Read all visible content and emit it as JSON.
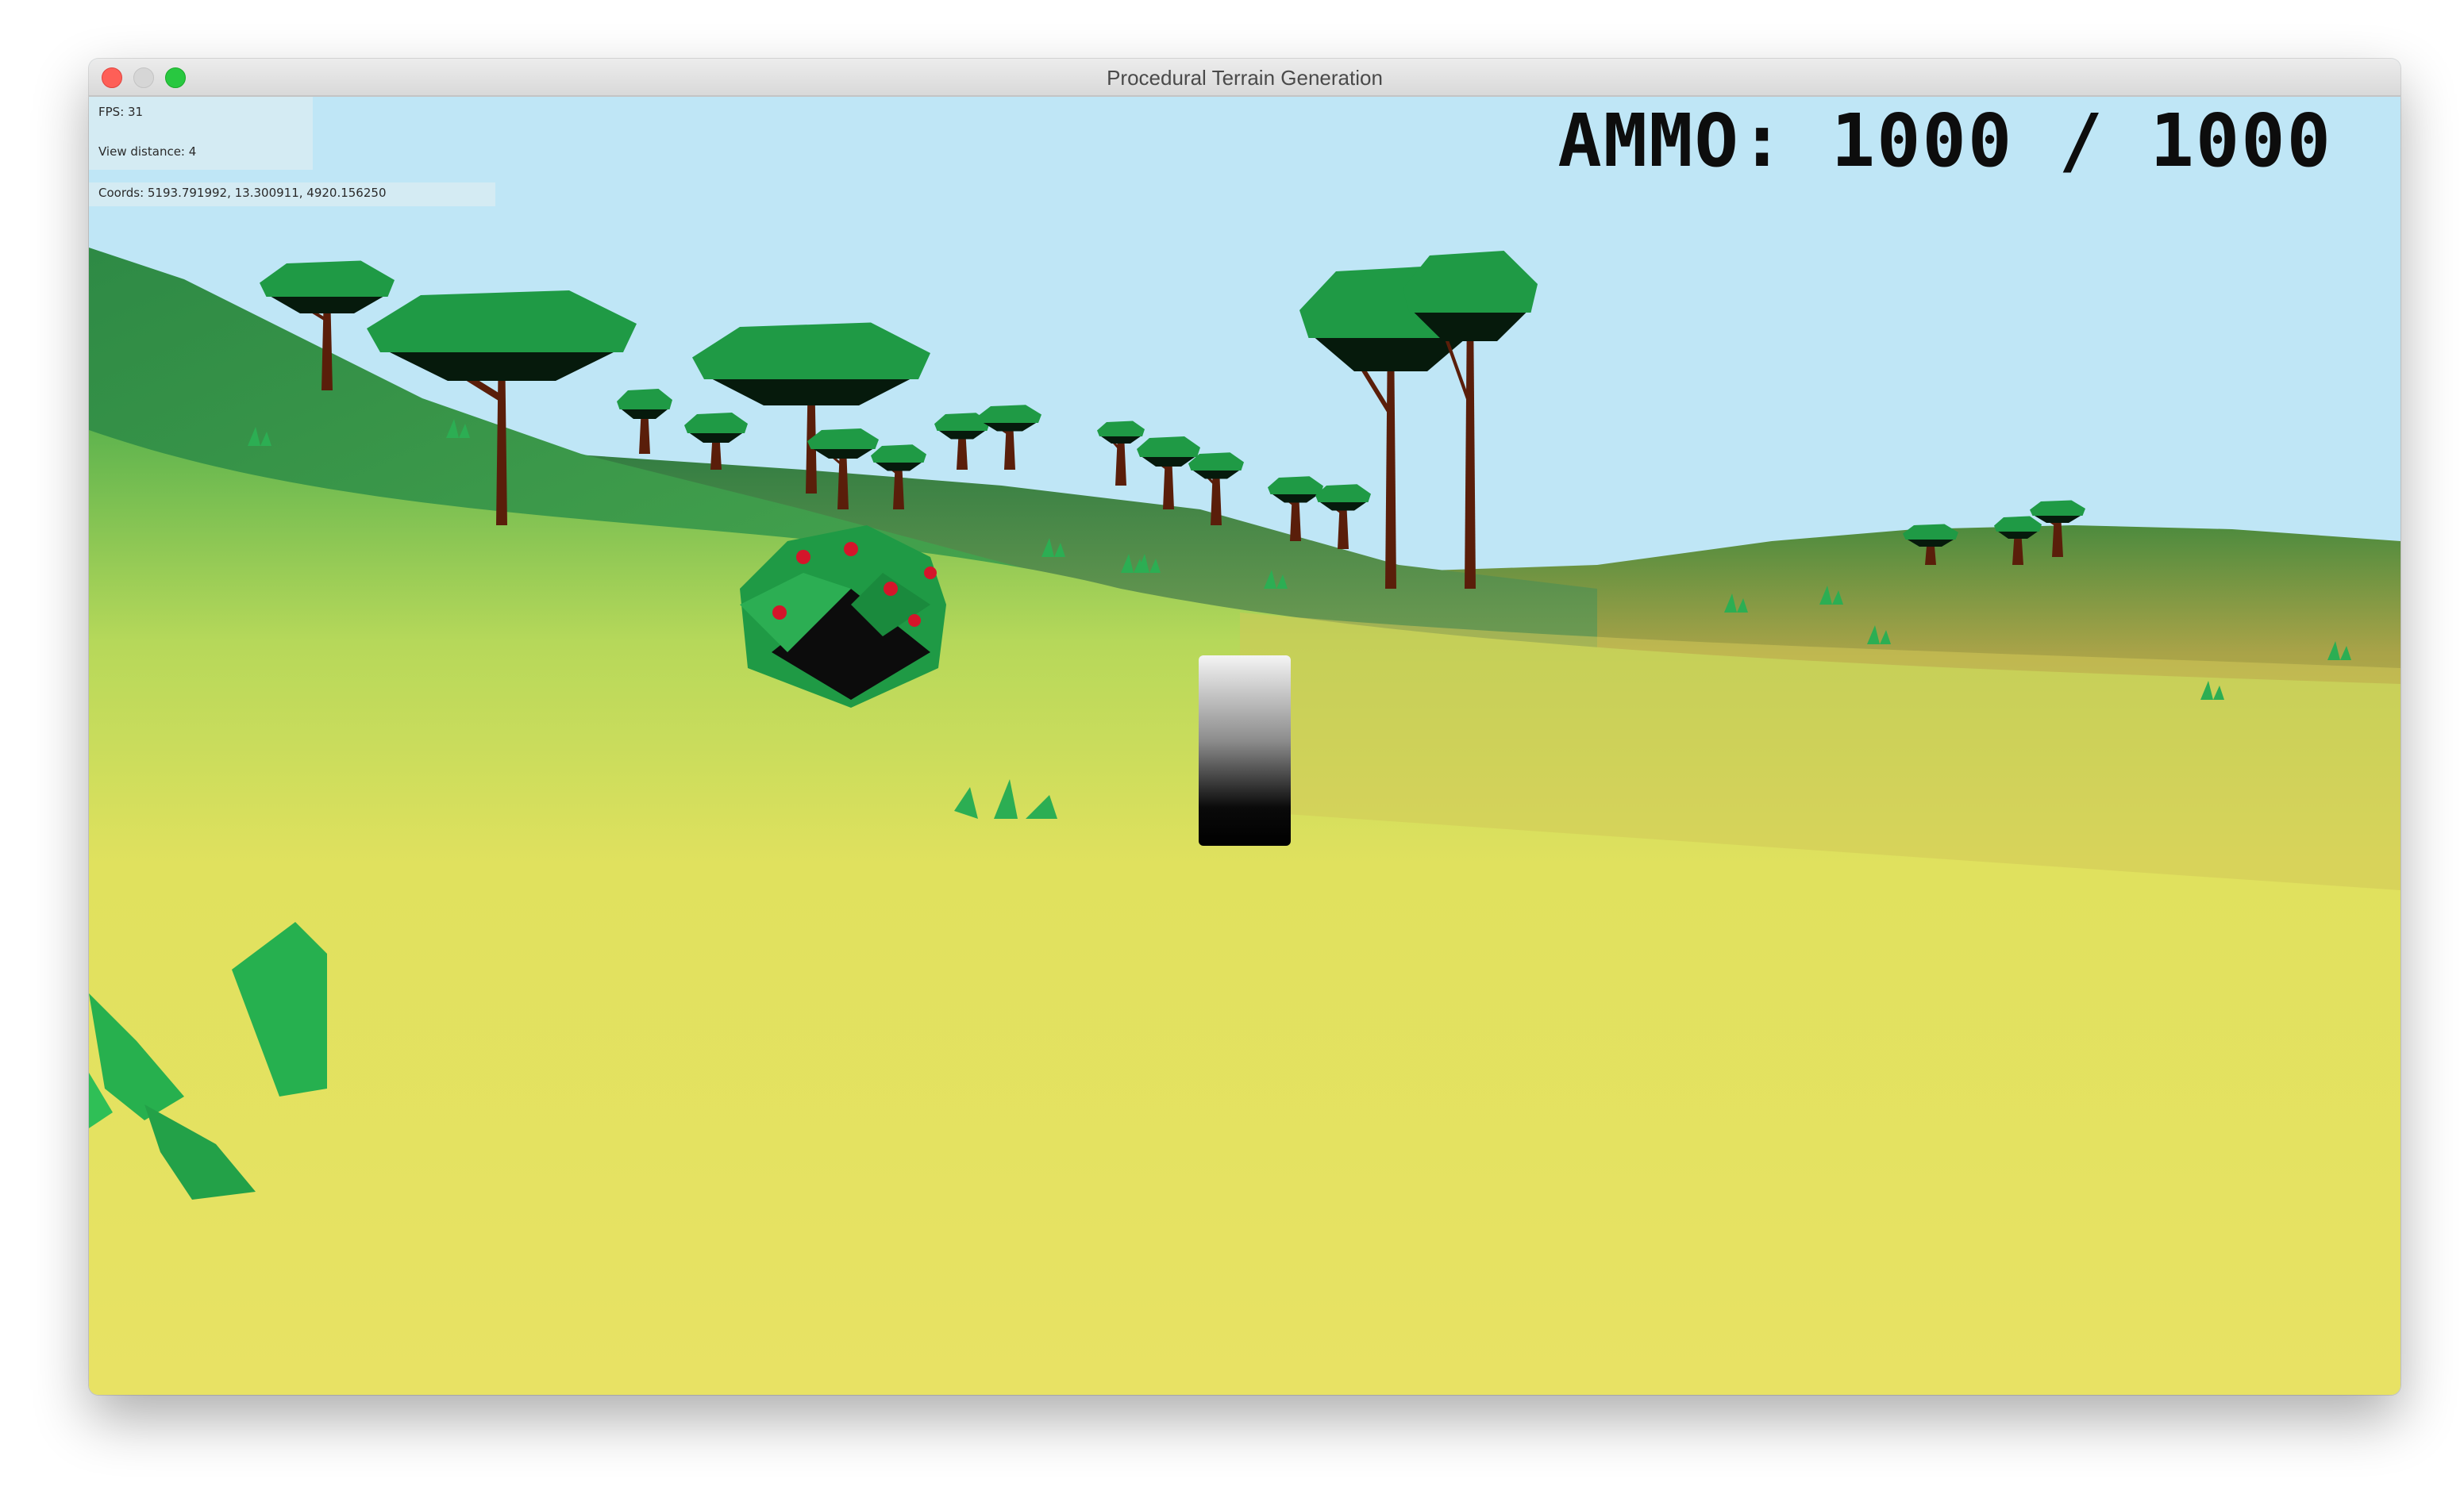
{
  "window": {
    "title": "Procedural Terrain Generation",
    "buttons": [
      "close",
      "minimize",
      "maximize"
    ]
  },
  "hud": {
    "fps": "FPS: 31",
    "view_distance": "View distance: 4",
    "coords": "Coords: 5193.791992, 13.300911, 4920.156250",
    "ammo": "AMMO: 1000 / 1000"
  },
  "scene": {
    "sky_color": "#bfe6f6",
    "grass_color": "#e6e25e",
    "hill_color": "#2f9a4a",
    "foliage_color": "#1f9a45",
    "trunk_color": "#5a1e0a",
    "berry_color": "#d4152a",
    "objects": [
      "low-poly trees",
      "berry bush",
      "grass tufts",
      "gradient pillar"
    ]
  }
}
